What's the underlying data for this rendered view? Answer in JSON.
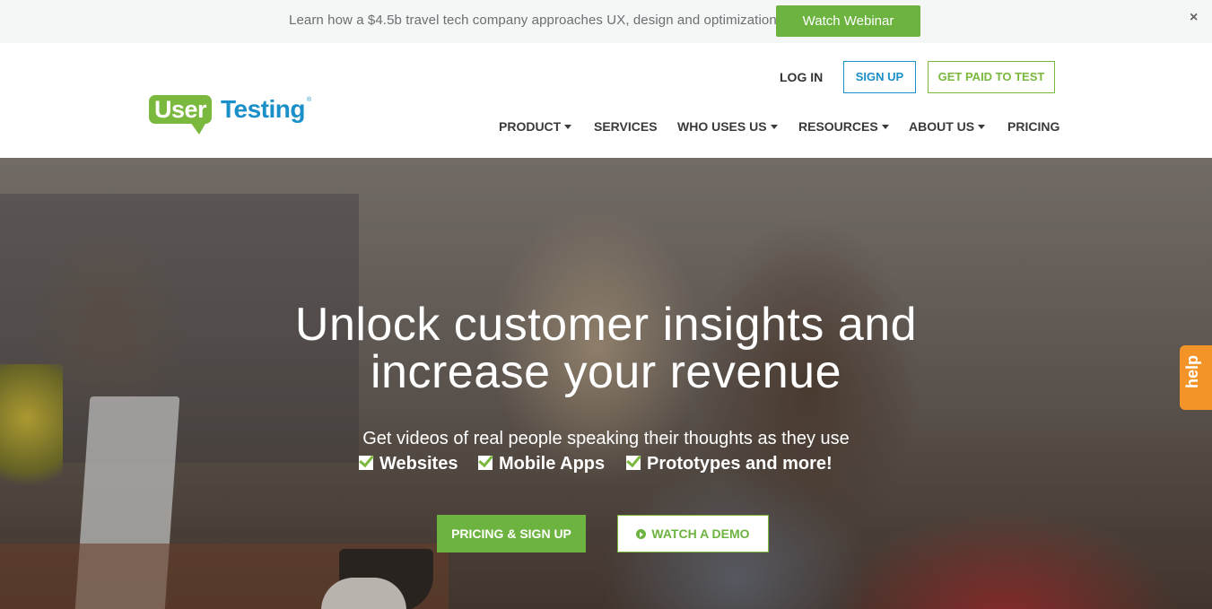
{
  "announcement": {
    "text": "Learn how a $4.5b travel tech company approaches UX, design and optimization",
    "button_label": "Watch Webinar",
    "close_label": "×"
  },
  "header": {
    "logo_user": "User",
    "logo_testing": "Testing",
    "logo_reg": "®",
    "login": "LOG IN",
    "signup": "SIGN UP",
    "get_paid": "GET PAID TO TEST",
    "nav": [
      "PRODUCT",
      "SERVICES",
      "WHO USES US",
      "RESOURCES",
      "ABOUT US",
      "PRICING"
    ]
  },
  "hero": {
    "headline_line1": "Unlock customer insights and",
    "headline_line2": "increase your revenue",
    "subline": "Get videos of real people speaking their thoughts as they use",
    "checks": [
      "Websites",
      "Mobile Apps",
      "Prototypes and more!"
    ],
    "cta_primary": "PRICING & SIGN UP",
    "cta_secondary": "WATCH A DEMO"
  },
  "help_tab": "help",
  "colors": {
    "brand_green": "#6db33f",
    "brand_blue": "#1a8fc8",
    "help_orange": "#f29427"
  }
}
